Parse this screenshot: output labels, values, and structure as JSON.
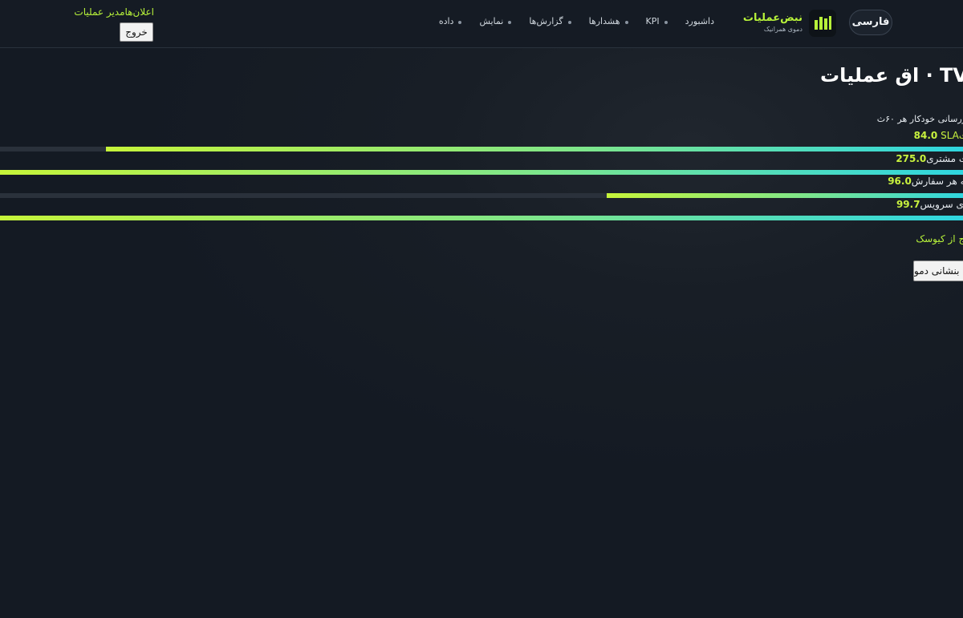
{
  "header": {
    "language_label": "فارسی",
    "brand_name": "نبض‌عملیات",
    "brand_subtitle": "دموی همرانیک",
    "nav": [
      {
        "label": "داشبورد"
      },
      {
        "label": "KPI"
      },
      {
        "label": "هشدارها"
      },
      {
        "label": "گزارش‌ها"
      },
      {
        "label": "نمایش"
      },
      {
        "label": "داده"
      }
    ],
    "user_text": "اعلان‌هامدیر عملیات",
    "logout_label": "خروج"
  },
  "main": {
    "title": "اق عملیات · TV",
    "refresh_note": "زرسانی خودکار هر ۶۰ث",
    "kpis": [
      {
        "prefix": "یت",
        "label": " SLA",
        "value": "84.0",
        "progress": 0.89
      },
      {
        "prefix": "",
        "label": "یت مشتری",
        "value": "275.0",
        "progress": 1.0
      },
      {
        "prefix": "",
        "label": "ینه هر سفارش",
        "value": "96.0",
        "progress": 0.37
      },
      {
        "prefix": "",
        "label": "اری سرویس",
        "value": "99.7",
        "progress": 1.0
      }
    ],
    "kiosk_link": "وج از کیوسک",
    "reset_label": "بنشانی دمو"
  },
  "colors": {
    "accent": "#b7f23a",
    "gradient_start": "#c6f43a",
    "gradient_end": "#2fd6e0",
    "background": "#141a23"
  }
}
